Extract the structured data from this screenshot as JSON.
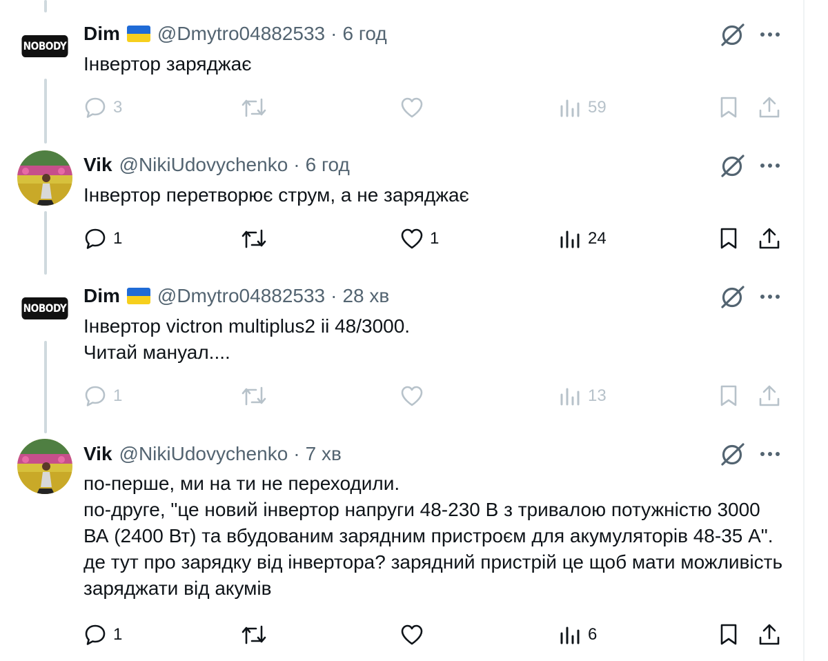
{
  "tweets": [
    {
      "avatar": {
        "type": "logo",
        "label": "NOBODY"
      },
      "display_name": "Dim",
      "has_flag": true,
      "handle": "@Dmytro04882533",
      "separator": "·",
      "time": "6 год",
      "body": [
        "Інвертор заряджає"
      ],
      "actions": {
        "replies": "3",
        "retweets": "",
        "likes": "",
        "views": "59"
      },
      "action_style": "muted-light"
    },
    {
      "avatar": {
        "type": "photo"
      },
      "display_name": "Vik",
      "has_flag": false,
      "handle": "@NikiUdovychenko",
      "separator": "·",
      "time": "6 год",
      "body": [
        "Інвертор перетворює струм, а не заряджає"
      ],
      "actions": {
        "replies": "1",
        "retweets": "",
        "likes": "1",
        "views": "24"
      },
      "action_style": "dark"
    },
    {
      "avatar": {
        "type": "logo",
        "label": "NOBODY"
      },
      "display_name": "Dim",
      "has_flag": true,
      "handle": "@Dmytro04882533",
      "separator": "·",
      "time": "28 хв",
      "body": [
        "Інвертор victron multiplus2 ii 48/3000.",
        "Читай мануал...."
      ],
      "actions": {
        "replies": "1",
        "retweets": "",
        "likes": "",
        "views": "13"
      },
      "action_style": "muted-light"
    },
    {
      "avatar": {
        "type": "photo"
      },
      "display_name": "Vik",
      "has_flag": false,
      "handle": "@NikiUdovychenko",
      "separator": "·",
      "time": "7 хв",
      "body": [
        "по-перше, ми на ти не переходили.",
        "по-друге, \"це новий інвертор напруги 48-230 В з тривалою потужністю 3000 ВА (2400 Вт) та вбудованим зарядним пристроєм для акумуляторів 48-35 А\". де тут про зарядку від інвертора? зарядний пристрій це щоб мати можливість заряджати від акумів"
      ],
      "actions": {
        "replies": "1",
        "retweets": "",
        "likes": "",
        "views": "6"
      },
      "action_style": "dark"
    }
  ],
  "colors": {
    "text_primary": "#0f1419",
    "text_secondary": "#536471",
    "icon_muted": "#b7c2ca",
    "thread_line": "#cfd9de",
    "flag_blue": "#1f6bd6",
    "flag_yellow": "#f6cf1d"
  },
  "icons": {
    "reply": "reply-icon",
    "retweet": "retweet-icon",
    "like": "heart-icon",
    "views": "views-chart-icon",
    "bookmark": "bookmark-icon",
    "share": "share-icon",
    "grok": "grok-icon",
    "more": "more-icon"
  }
}
